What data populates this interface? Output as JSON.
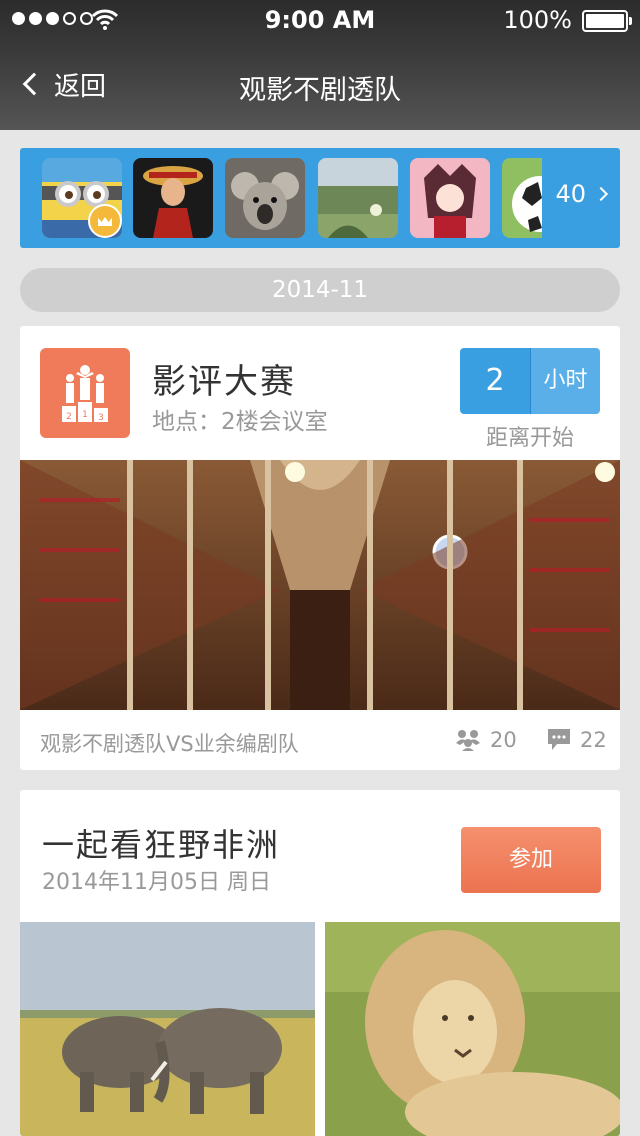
{
  "status_bar": {
    "time": "9:00 AM",
    "battery": "100%"
  },
  "nav": {
    "back_label": "返回",
    "title": "观影不剧透队"
  },
  "members": {
    "count": "40"
  },
  "date_header": "2014-11",
  "event1": {
    "title": "影评大赛",
    "location": "地点：2楼会议室",
    "countdown_value": "2",
    "countdown_unit": "小时",
    "countdown_caption": "距离开始",
    "footer_text": "观影不剧透队VS业余编剧队",
    "participants": "20",
    "comments": "22"
  },
  "event2": {
    "title": "一起看狂野非洲",
    "date": "2014年11月05日  周日",
    "join_label": "参加"
  },
  "colors": {
    "accent_blue": "#3a9fe0",
    "accent_orange": "#f07b5a",
    "background": "#e6e6e6"
  }
}
